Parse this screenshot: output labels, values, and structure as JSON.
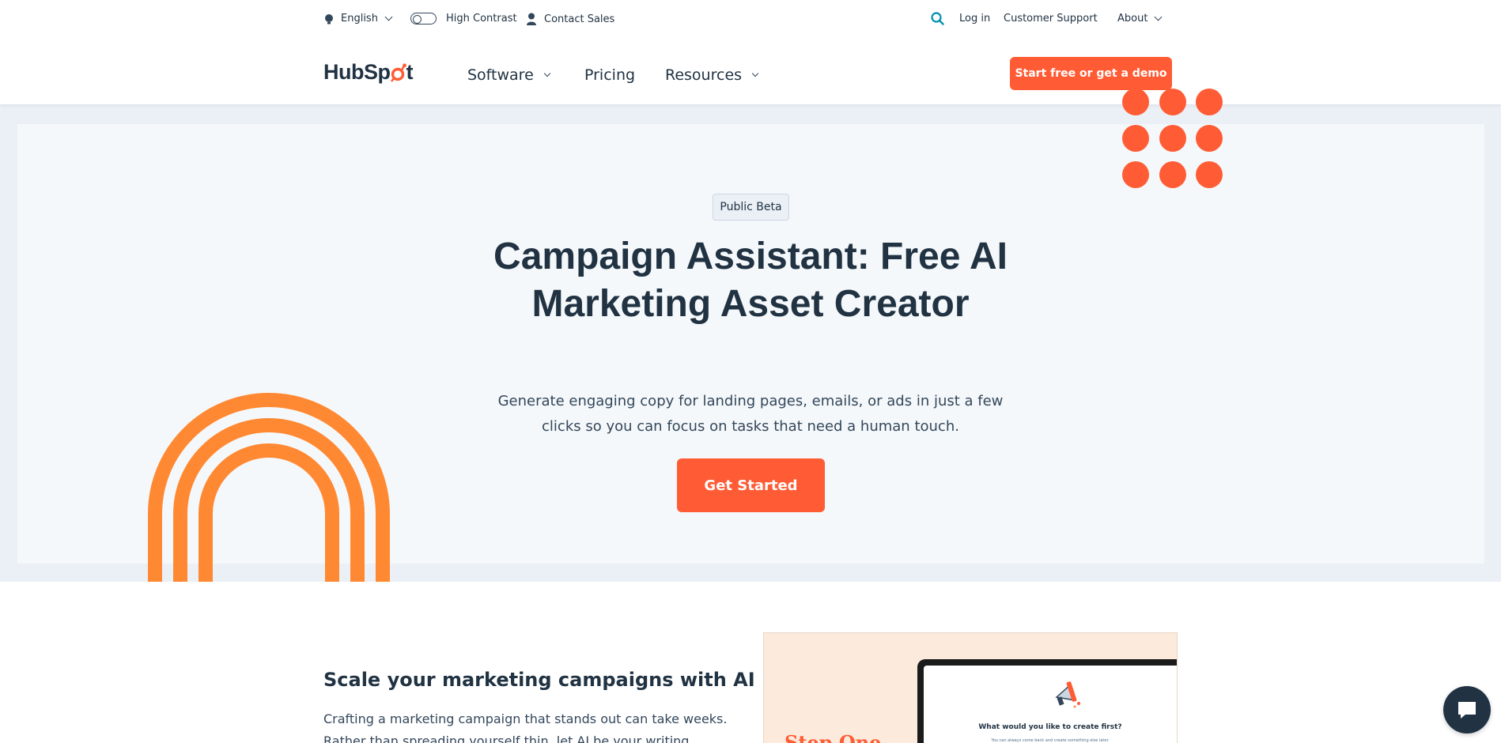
{
  "utility_bar": {
    "language_label": "English",
    "high_contrast_label": "High Contrast",
    "contact_sales_label": "Contact Sales",
    "login_label": "Log in",
    "support_label": "Customer Support",
    "about_label": "About"
  },
  "nav": {
    "logo_text_a": "HubSp",
    "logo_text_b": "t",
    "items": [
      {
        "label": "Software",
        "has_dropdown": true
      },
      {
        "label": "Pricing",
        "has_dropdown": false
      },
      {
        "label": "Resources",
        "has_dropdown": true
      }
    ],
    "cta_label": "Start free or get a demo"
  },
  "hero": {
    "badge": "Public Beta",
    "title": "Campaign Assistant: Free AI Marketing Asset Creator",
    "subtitle": "Generate engaging copy for landing pages, emails, or ads in just a few clicks so you can focus on tasks that need a human touch.",
    "cta_label": "Get Started"
  },
  "section": {
    "title": "Scale your marketing campaigns with AI",
    "body": "Crafting a marketing campaign that stands out can take weeks. Rather than spreading yourself thin, let AI be your writing assistant."
  },
  "preview": {
    "step_label": "Step One",
    "question": "What would you like to create first?",
    "note": "You can always come back and create something else later."
  },
  "colors": {
    "brand_orange": "#ff5c35",
    "arch_orange": "#ff8933",
    "text_dark": "#213343",
    "hero_bg": "#f5f8fa",
    "hero_outer_bg": "#eaf0f6",
    "search_icon": "#0091ae"
  },
  "icons": [
    "globe-icon",
    "contrast-toggle-icon",
    "person-icon",
    "search-icon",
    "chevron-down-icon",
    "sprocket-icon",
    "chat-icon",
    "megaphone-icon"
  ]
}
